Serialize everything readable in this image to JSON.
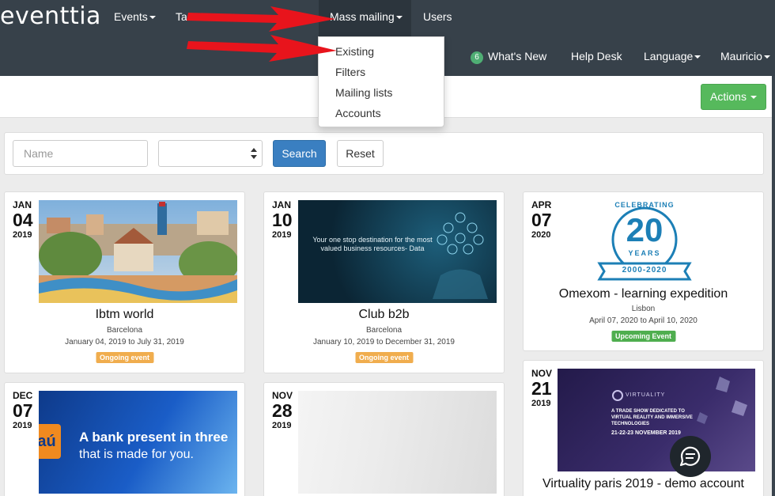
{
  "brand": {
    "logo": "eventtia"
  },
  "nav": {
    "events": "Events",
    "truncated": "Ta",
    "mass_mailing": "Mass mailing",
    "users": "Users",
    "whats_new_count": "6",
    "whats_new": "What's New",
    "help_desk": "Help Desk",
    "language": "Language",
    "user": "Mauricio"
  },
  "mass_mailing_menu": [
    "Existing",
    "Filters",
    "Mailing lists",
    "Accounts"
  ],
  "actions_label": "Actions",
  "search": {
    "name_placeholder": "Name",
    "select_value": "",
    "search_label": "Search",
    "reset_label": "Reset"
  },
  "events": [
    {
      "month": "JAN",
      "day": "04",
      "year": "2019",
      "title": "Ibtm world",
      "location": "Barcelona",
      "dates": "January 04, 2019 to July 31, 2019",
      "status": "Ongoing event"
    },
    {
      "month": "JAN",
      "day": "10",
      "year": "2019",
      "title": "Club b2b",
      "location": "Barcelona",
      "dates": "January 10, 2019 to December 31, 2019",
      "status": "Ongoing event",
      "image_text": "Your one stop destination for the most valued business resources- Data"
    },
    {
      "month": "APR",
      "day": "07",
      "year": "2020",
      "title": "Omexom - learning expedition",
      "location": "Lisbon",
      "dates": "April 07, 2020 to April 10, 2020",
      "status": "Upcoming Event",
      "logo_top": "CELEBRATING",
      "logo_num": "20",
      "logo_mid": "YEARS",
      "logo_ribbon": "2000-2020"
    },
    {
      "month": "DEC",
      "day": "07",
      "year": "2019",
      "image_line1": "A bank present in three",
      "image_line2": "that is made for you.",
      "image_logo": "aú"
    },
    {
      "month": "NOV",
      "day": "28",
      "year": "2019"
    },
    {
      "month": "NOV",
      "day": "21",
      "year": "2019",
      "title": "Virtuality paris 2019 - demo account",
      "image_brand": "VIRTUALITY",
      "image_tagline": "A TRADE SHOW DEDICATED TO VIRTUAL REALITY AND IMMERSIVE TECHNOLOGIES",
      "image_date": "21-22-23 NOVEMBER 2019"
    }
  ],
  "colors": {
    "navbar": "#37414a",
    "search_button": "#3a7fc1",
    "actions_button": "#56b95c",
    "ongoing": "#f0ad4e",
    "upcoming": "#4fae4f",
    "annotation_arrow": "#e8141c"
  },
  "icons": {
    "chat": "chat-bubble-icon",
    "caret": "caret-down-icon",
    "arrow": "red-arrow-annotation"
  }
}
